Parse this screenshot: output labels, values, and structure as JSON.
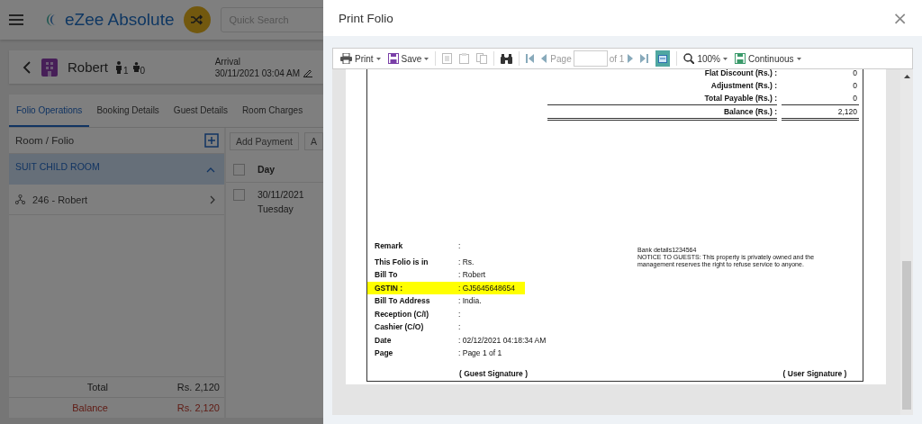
{
  "app": {
    "brand": "eZee Absolute",
    "search": {
      "placeholder": "Quick Search"
    }
  },
  "booking": {
    "guest": "Robert",
    "adults": "1",
    "children": "0",
    "arrival_label": "Arrival",
    "arrival": "30/11/2021 03:04 AM"
  },
  "tabs": [
    {
      "label": "Folio Operations",
      "selected": true
    },
    {
      "label": "Booking Details",
      "selected": false
    },
    {
      "label": "Guest Details",
      "selected": false
    },
    {
      "label": "Room Charges",
      "selected": false
    }
  ],
  "folio_panel": {
    "header": "Room / Folio",
    "groups": [
      {
        "label": "SUIT CHILD ROOM",
        "expanded": true,
        "children": [
          {
            "label": "246 - Robert"
          }
        ]
      }
    ]
  },
  "actions": [
    "Add Payment",
    "A"
  ],
  "charges_table": {
    "select_all_checked": false,
    "columns": [
      "Day"
    ],
    "rows": [
      {
        "day": "30/11/2021",
        "weekday": "Tuesday",
        "checked": false
      }
    ]
  },
  "totals": [
    {
      "kind": "total",
      "label": "Total",
      "value": "Rs. 2,120"
    },
    {
      "kind": "balance",
      "label": "Balance",
      "value": "Rs. 2,120"
    }
  ],
  "dialog": {
    "title": "Print Folio",
    "close": "×",
    "toolbar": {
      "print": "Print",
      "save": "Save",
      "page_label": "Page",
      "page_count": "of 1",
      "zoom": "100%",
      "view_mode": "Continuous",
      "single_page_active": true
    },
    "report": {
      "summary": [
        {
          "label": "Flat Discount (Rs.) :",
          "value": "0"
        },
        {
          "label": "Adjustment (Rs.) :",
          "value": "0"
        },
        {
          "label": "Total Payable (Rs.) :",
          "value": "0"
        }
      ],
      "balance": {
        "label": "Balance (Rs.) :",
        "value": "2,120"
      },
      "info": [
        {
          "label": "Remark",
          "value": ":",
          "highlighted": false
        },
        {
          "label": "This Folio is in",
          "value": ": Rs.",
          "highlighted": false
        },
        {
          "label": "Bill To",
          "value": ": Robert",
          "highlighted": false
        },
        {
          "label": "GSTIN :",
          "value": ": GJ5645648654",
          "highlighted": true
        },
        {
          "label": "Bill To Address",
          "value": ":  India.",
          "highlighted": false
        },
        {
          "label": "Reception (C/I)",
          "value": ":",
          "highlighted": false
        },
        {
          "label": "Cashier (C/O)",
          "value": ":",
          "highlighted": false
        },
        {
          "label": "Date",
          "value": ": 02/12/2021 04:18:34 AM",
          "highlighted": false
        },
        {
          "label": "Page",
          "value": ": Page 1 of 1",
          "highlighted": false
        }
      ],
      "notice": [
        "Bank details1234564",
        "NOTICE TO GUESTS: This property is privately owned and the management reserves the right to refuse service to anyone."
      ],
      "signatures": [
        "( Guest Signature )",
        "( User Signature )"
      ]
    }
  }
}
